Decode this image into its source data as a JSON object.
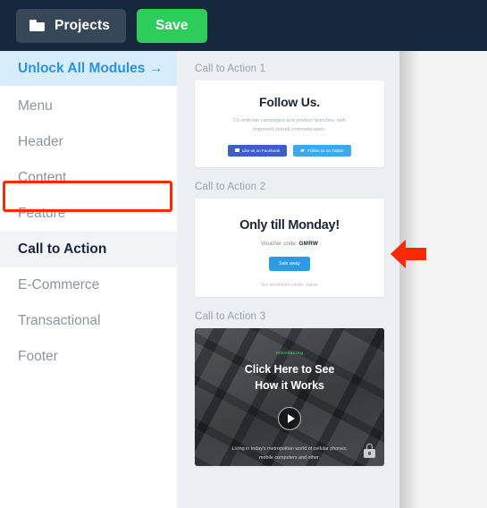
{
  "topbar": {
    "projects_label": "Projects",
    "save_label": "Save",
    "folder_icon": "folder-icon",
    "bg_color": "#16283c",
    "save_color": "#2ecc5a"
  },
  "sidebar": {
    "items": [
      {
        "label": "Unlock All Modules →",
        "state": "promo"
      },
      {
        "label": "Menu",
        "state": "default"
      },
      {
        "label": "Header",
        "state": "default"
      },
      {
        "label": "Content",
        "state": "default"
      },
      {
        "label": "Feature",
        "state": "default"
      },
      {
        "label": "Call to Action",
        "state": "active"
      },
      {
        "label": "E-Commerce",
        "state": "default"
      },
      {
        "label": "Transactional",
        "state": "default"
      },
      {
        "label": "Footer",
        "state": "default"
      }
    ],
    "promo_color": "#2b93e0",
    "promo_bg": "#d7edfb",
    "active_bg": "#f2f3f4"
  },
  "content": {
    "sections": [
      {
        "label": "Call to Action 1"
      },
      {
        "label": "Call to Action 2"
      },
      {
        "label": "Call to Action 3"
      }
    ],
    "card1": {
      "title": "Follow Us.",
      "body": "Co-ordinate campaigns and product launches, with improved overall communication.",
      "facebook_label": "Like us on Facebook",
      "twitter_label": "Follow us on Twitter",
      "facebook_color": "#3d5fc4",
      "twitter_color": "#40a8e8"
    },
    "card2": {
      "title": "Only till Monday!",
      "voucher_prefix": "Voucher code:",
      "voucher_code": "GMRW",
      "button_label": "Sale away",
      "note": "No minimum order value",
      "button_color": "#2b9be6"
    },
    "card3": {
      "kicker": "Introducing",
      "title_line1": "Click Here to See",
      "title_line2": "How it Works",
      "body": "Living in today's metropolitan world of cellular phones, mobile computers and other.",
      "play_icon": "play-icon",
      "lock_icon": "lock-icon",
      "kicker_color": "#3fc96a"
    }
  },
  "annotations": {
    "highlight_box_color": "#fa2a00",
    "arrow_color": "#fa2a00",
    "arrow_direction": "left"
  }
}
